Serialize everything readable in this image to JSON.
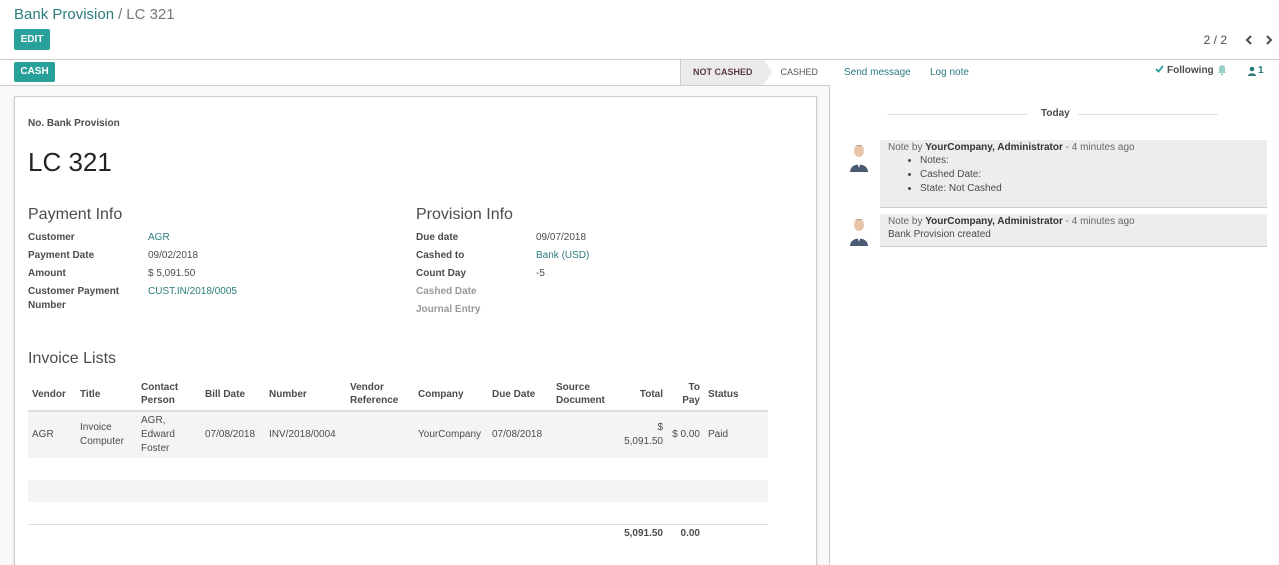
{
  "breadcrumb": {
    "parent": "Bank Provision",
    "separator": "/",
    "current": "LC 321"
  },
  "toolbar": {
    "edit_label": "EDIT"
  },
  "pager": {
    "value": "2 / 2"
  },
  "statusbar": {
    "cash_label": "CASH",
    "steps": [
      "NOT CASHED",
      "CASHED"
    ],
    "active_step": "NOT CASHED"
  },
  "form": {
    "name_label": "No. Bank Provision",
    "name": "LC 321",
    "payment_info": {
      "title": "Payment Info",
      "customer_label": "Customer",
      "customer": "AGR",
      "payment_date_label": "Payment Date",
      "payment_date": "09/02/2018",
      "amount_label": "Amount",
      "amount": "$ 5,091.50",
      "customer_payment_label": "Customer Payment Number",
      "customer_payment": "CUST.IN/2018/0005"
    },
    "provision_info": {
      "title": "Provision Info",
      "due_date_label": "Due date",
      "due_date": "09/07/2018",
      "cashed_to_label": "Cashed to",
      "cashed_to": "Bank (USD)",
      "count_day_label": "Count Day",
      "count_day": "-5",
      "cashed_date_label": "Cashed Date",
      "journal_entry_label": "Journal Entry"
    },
    "invoice_lists": {
      "title": "Invoice Lists",
      "columns": [
        "Vendor",
        "Title",
        "Contact Person",
        "Bill Date",
        "Number",
        "Vendor Reference",
        "Company",
        "Due Date",
        "Source Document",
        "Total",
        "To Pay",
        "Status"
      ],
      "rows": [
        {
          "vendor": "AGR",
          "title": "Invoice Computer",
          "contact": "AGR, Edward Foster",
          "bill_date": "07/08/2018",
          "number": "INV/2018/0004",
          "vendor_ref": "",
          "company": "YourCompany",
          "due_date": "07/08/2018",
          "source": "",
          "total": "$ 5,091.50",
          "to_pay": "$ 0.00",
          "status": "Paid"
        }
      ],
      "totals": {
        "total": "5,091.50",
        "to_pay": "0.00"
      }
    }
  },
  "chatter": {
    "send_message": "Send message",
    "log_note": "Log note",
    "following": "Following",
    "followers_count": "1",
    "date_separator": "Today",
    "messages": [
      {
        "prefix": "Note by",
        "author": "YourCompany, Administrator",
        "time": "- 4 minutes ago",
        "items": [
          "Notes:",
          "Cashed Date:",
          "State: Not Cashed"
        ]
      },
      {
        "prefix": "Note by",
        "author": "YourCompany, Administrator",
        "time": "- 4 minutes ago",
        "body": "Bank Provision created"
      }
    ]
  },
  "colors": {
    "primary": "#27a19a",
    "link": "#2b7b7b",
    "active_status": "#5e394a"
  }
}
